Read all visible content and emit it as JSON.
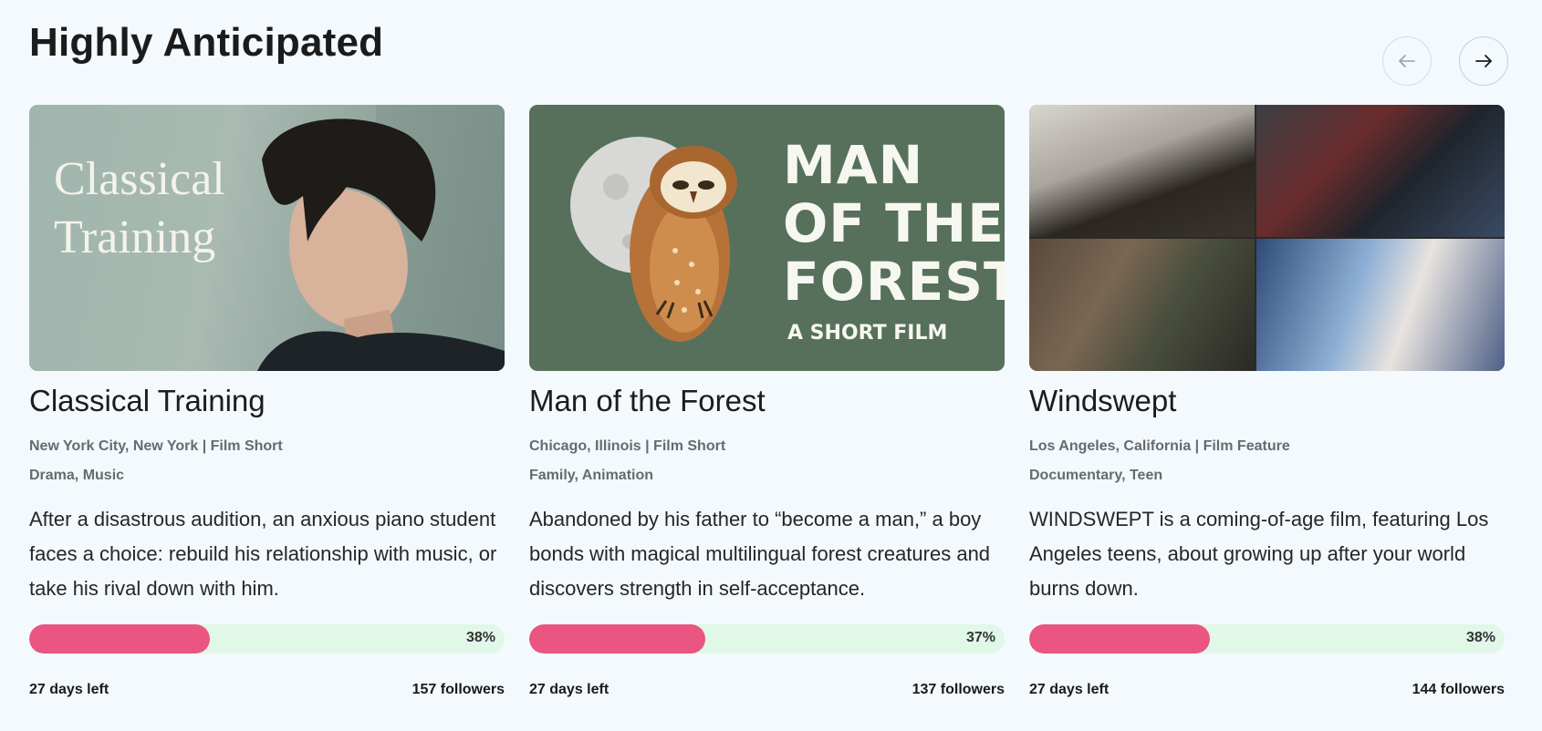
{
  "section": {
    "title": "Highly Anticipated",
    "prev_icon": "arrow-left-icon",
    "next_icon": "arrow-right-icon"
  },
  "colors": {
    "progress_fill": "#ea5581",
    "progress_track": "#e1f7e8",
    "background": "#f3f9fc"
  },
  "cards": [
    {
      "title": "Classical Training",
      "location": "New York City, New York | Film Short",
      "genres": "Drama, Music",
      "description": "After a disastrous audition, an anxious piano student faces a choice: rebuild his relationship with music, or take his rival down with him.",
      "progress": 38,
      "progress_label": "38%",
      "days_left": "27 days left",
      "followers": "157 followers",
      "thumbnail_text": "Classical Training"
    },
    {
      "title": "Man of the Forest",
      "location": "Chicago, Illinois | Film Short",
      "genres": "Family, Animation",
      "description": "Abandoned by his father to “become a man,” a boy bonds with magical multilingual forest creatures and discovers strength in self-acceptance.",
      "progress": 37,
      "progress_label": "37%",
      "days_left": "27 days left",
      "followers": "137 followers",
      "thumbnail_title": "MAN OF THE FOREST",
      "thumbnail_subtitle": "A SHORT FILM"
    },
    {
      "title": "Windswept",
      "location": "Los Angeles, California | Film Feature",
      "genres": "Documentary, Teen",
      "description": "WINDSWEPT is a coming-of-age film, featuring Los Angeles teens, about growing up after your world burns down.",
      "progress": 38,
      "progress_label": "38%",
      "days_left": "27 days left",
      "followers": "144 followers"
    }
  ]
}
